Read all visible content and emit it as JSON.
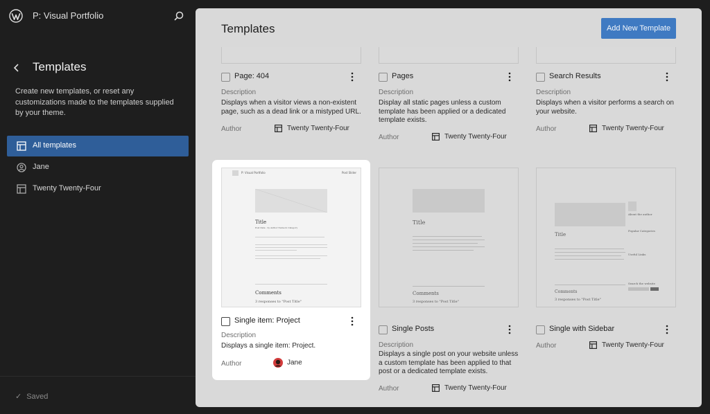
{
  "app": {
    "site_title": "P: Visual Portfolio"
  },
  "sidebar": {
    "heading": "Templates",
    "description": "Create new templates, or reset any customizations made to the templates supplied by your theme.",
    "nav": [
      {
        "label": "All templates",
        "active": true
      },
      {
        "label": "Jane",
        "active": false
      },
      {
        "label": "Twenty Twenty-Four",
        "active": false
      }
    ],
    "status": "Saved"
  },
  "main": {
    "title": "Templates",
    "add_button": "Add New Template",
    "row1": [
      {
        "title": "Page: 404",
        "desc_label": "Description",
        "description": "Displays when a visitor views a non-existent page, such as a dead link or a mistyped URL.",
        "author_label": "Author",
        "author": "Twenty Twenty-Four"
      },
      {
        "title": "Pages",
        "desc_label": "Description",
        "description": "Display all static pages unless a custom template has been applied or a dedicated template exists.",
        "author_label": "Author",
        "author": "Twenty Twenty-Four"
      },
      {
        "title": "Search Results",
        "desc_label": "Description",
        "description": "Displays when a visitor performs a search on your website.",
        "author_label": "Author",
        "author": "Twenty Twenty-Four"
      }
    ],
    "row2": [
      {
        "title": "Single item: Project",
        "desc_label": "Description",
        "description": "Displays a single item: Project.",
        "author_label": "Author",
        "author": "Jane"
      },
      {
        "title": "Single Posts",
        "desc_label": "Description",
        "description": "Displays a single post on your website unless a custom template has been applied to that post or a dedicated template exists.",
        "author_label": "Author",
        "author": "Twenty Twenty-Four"
      },
      {
        "title": "Single with Sidebar",
        "desc_label": "Description",
        "description": "",
        "author_label": "Author",
        "author": "Twenty Twenty-Four"
      }
    ],
    "preview": {
      "site": "P: Visual Portfolio",
      "nav": "Post Slider",
      "post_title": "Title",
      "meta": "Post Date · by Author Name in Category",
      "comments": "Comments",
      "responses": "3 responses to \"Post Title\"",
      "sidebar_about": "About the author",
      "sidebar_categories": "Popular Categories",
      "sidebar_links": "Useful Links",
      "sidebar_search": "Search the website"
    }
  },
  "colors": {
    "accent": "#3f7ac2",
    "active_nav": "#2f5e99"
  }
}
